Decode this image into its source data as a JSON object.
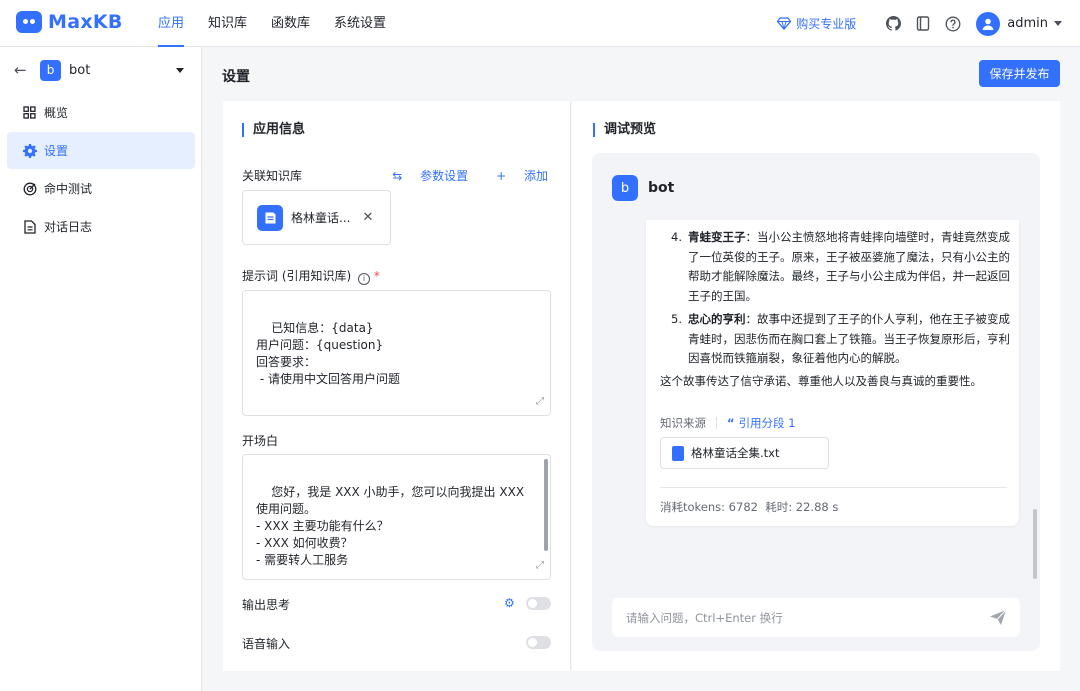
{
  "brand": {
    "name": "MaxKB"
  },
  "topnav": {
    "items": [
      "应用",
      "知识库",
      "函数库",
      "系统设置"
    ],
    "active_index": 0
  },
  "topright": {
    "pro_label": "购买专业版",
    "user": "admin"
  },
  "sidebar": {
    "app_name": "bot",
    "app_badge": "b",
    "items": [
      {
        "label": "概览",
        "icon": "grid-icon"
      },
      {
        "label": "设置",
        "icon": "gear-icon",
        "active": true
      },
      {
        "label": "命中测试",
        "icon": "target-icon"
      },
      {
        "label": "对话日志",
        "icon": "document-icon"
      }
    ]
  },
  "page": {
    "title": "设置",
    "publish_label": "保存并发布"
  },
  "settings": {
    "section_title": "应用信息",
    "kb_label": "关联知识库",
    "param_label": "参数设置",
    "add_label": "添加",
    "kb_name": "格林童话...",
    "prompt_label": "提示词 (引用知识库)",
    "required_mark": "*",
    "prompt_text": "已知信息：{data}\n用户问题：{question}\n回答要求：\n - 请使用中文回答用户问题",
    "opening_label": "开场白",
    "opening_text": "您好，我是 XXX 小助手，您可以向我提出 XXX 使用问题。\n- XXX 主要功能有什么？\n- XXX 如何收费？\n- 需要转人工服务",
    "output_thinking_label": "输出思考",
    "voice_input_label": "语音输入"
  },
  "preview": {
    "section_title": "调试预览",
    "bot_name": "bot",
    "bot_badge": "b",
    "answer_items": [
      {
        "num": "4.",
        "title": "青蛙变王子",
        "text": "：当小公主愤怒地将青蛙摔向墙壁时，青蛙竟然变成了一位英俊的王子。原来，王子被巫婆施了魔法，只有小公主的帮助才能解除魔法。最终，王子与小公主成为伴侣，并一起返回王子的王国。"
      },
      {
        "num": "5.",
        "title": "忠心的亨利",
        "text": "：故事中还提到了王子的仆人亨利，他在王子被变成青蛙时，因悲伤而在胸口套上了铁箍。当王子恢复原形后，亨利因喜悦而铁箍崩裂，象征着他内心的解脱。"
      }
    ],
    "summary": "这个故事传达了信守承诺、尊重他人以及善良与真诚的重要性。",
    "source_label": "知识来源",
    "cite_label": "引用分段 1",
    "file_name": "格林童话全集.txt",
    "tokens_label": "消耗tokens: 6782",
    "time_label": "耗时: 22.88 s",
    "input_placeholder": "请输入问题，Ctrl+Enter 换行"
  }
}
